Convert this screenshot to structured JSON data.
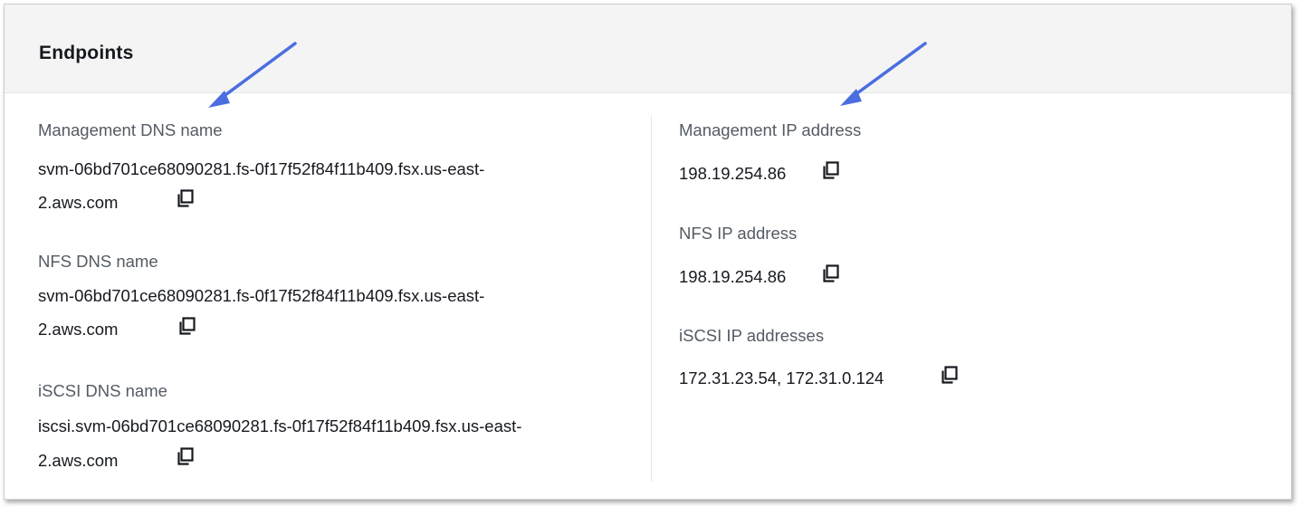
{
  "panel": {
    "title": "Endpoints"
  },
  "left_column": {
    "management_dns": {
      "label": "Management DNS name",
      "value_line1": "svm-06bd701ce68090281.fs-0f17f52f84f11b409.fsx.us-east-",
      "value_line2": "2.aws.com"
    },
    "nfs_dns": {
      "label": "NFS DNS name",
      "value_line1": "svm-06bd701ce68090281.fs-0f17f52f84f11b409.fsx.us-east-",
      "value_line2": "2.aws.com"
    },
    "iscsi_dns": {
      "label": "iSCSI DNS name",
      "value_line1": "iscsi.svm-06bd701ce68090281.fs-0f17f52f84f11b409.fsx.us-east-",
      "value_line2": "2.aws.com"
    }
  },
  "right_column": {
    "management_ip": {
      "label": "Management IP address",
      "value": "198.19.254.86"
    },
    "nfs_ip": {
      "label": "NFS IP address",
      "value": "198.19.254.86"
    },
    "iscsi_ip": {
      "label": "iSCSI IP addresses",
      "value": "172.31.23.54, 172.31.0.124"
    }
  },
  "icons": {
    "copy": "copy-icon",
    "annotation_arrow": "arrow-icon"
  },
  "colors": {
    "arrow": "#4a6ee0",
    "header_bg": "#f4f4f4",
    "label": "#545b64",
    "value": "#16191f"
  }
}
